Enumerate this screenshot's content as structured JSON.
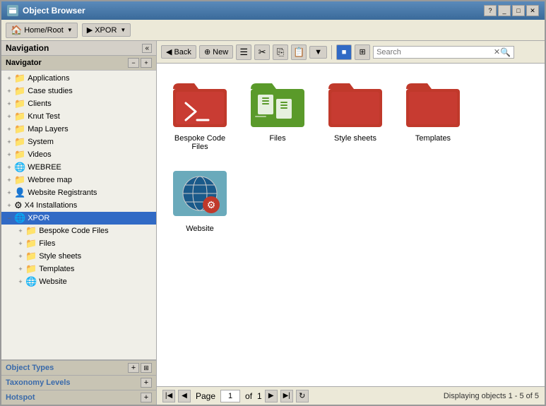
{
  "window": {
    "title": "Object Browser"
  },
  "address": {
    "home_label": "Home/Root",
    "current_label": "XPOR"
  },
  "toolbar": {
    "back_label": "Back",
    "new_label": "New",
    "search_placeholder": "Search"
  },
  "sidebar": {
    "navigation_title": "Navigation",
    "navigator_title": "Navigator",
    "tree_items": [
      {
        "label": "Applications",
        "level": 0,
        "expanded": false
      },
      {
        "label": "Case studies",
        "level": 0,
        "expanded": false
      },
      {
        "label": "Clients",
        "level": 0,
        "expanded": false
      },
      {
        "label": "Knut Test",
        "level": 0,
        "expanded": false
      },
      {
        "label": "Map Layers",
        "level": 0,
        "expanded": false
      },
      {
        "label": "System",
        "level": 0,
        "expanded": false
      },
      {
        "label": "Videos",
        "level": 0,
        "expanded": false
      },
      {
        "label": "WEBREE",
        "level": 0,
        "expanded": false
      },
      {
        "label": "Webree map",
        "level": 0,
        "expanded": false
      },
      {
        "label": "Website Registrants",
        "level": 0,
        "expanded": false
      },
      {
        "label": "X4 Installations",
        "level": 0,
        "expanded": false
      },
      {
        "label": "XPOR",
        "level": 0,
        "expanded": true,
        "selected": true,
        "children": [
          {
            "label": "Bespoke Code Files",
            "level": 1
          },
          {
            "label": "Files",
            "level": 1
          },
          {
            "label": "Style sheets",
            "level": 1
          },
          {
            "label": "Templates",
            "level": 1
          },
          {
            "label": "Website",
            "level": 1
          }
        ]
      }
    ],
    "object_types_title": "Object Types",
    "taxonomy_title": "Taxonomy Levels",
    "hotspot_title": "Hotspot"
  },
  "grid_items": [
    {
      "label": "Bespoke Code\nFiles",
      "type": "folder-red"
    },
    {
      "label": "Files",
      "type": "folder-green"
    },
    {
      "label": "Style sheets",
      "type": "folder-red"
    },
    {
      "label": "Templates",
      "type": "folder-red"
    },
    {
      "label": "Website",
      "type": "website-blue"
    }
  ],
  "status": {
    "page_label": "Page",
    "of_label": "of",
    "page_num": "1",
    "total_pages": "1",
    "display_text": "Displaying objects 1 - 5 of 5"
  }
}
